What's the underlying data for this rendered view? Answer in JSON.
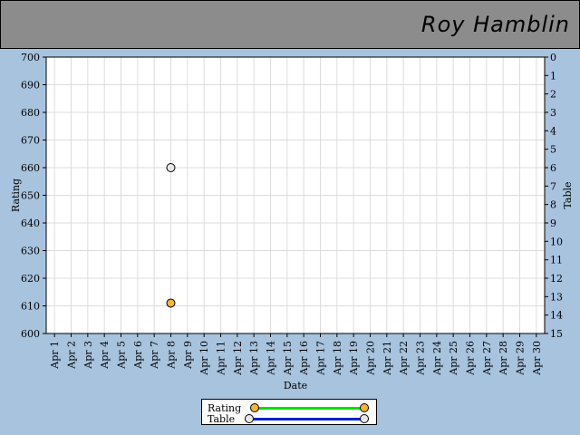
{
  "header": {
    "player_name": "Roy Hamblin"
  },
  "colors": {
    "rating_line": "#00e000",
    "rating_point": "#f5b72a",
    "table_line": "#0022cc",
    "table_point": "#e8e8e8",
    "background": "#a7c3de",
    "header_bg": "#8c8c8c"
  },
  "chart_data": {
    "type": "line",
    "xlabel": "Date",
    "ylabel_left": "Rating",
    "ylabel_right": "Table",
    "x_categories": [
      "Apr 1",
      "Apr 2",
      "Apr 3",
      "Apr 4",
      "Apr 5",
      "Apr 6",
      "Apr 7",
      "Apr 8",
      "Apr 9",
      "Apr 10",
      "Apr 11",
      "Apr 12",
      "Apr 13",
      "Apr 14",
      "Apr 15",
      "Apr 16",
      "Apr 17",
      "Apr 18",
      "Apr 19",
      "Apr 20",
      "Apr 21",
      "Apr 22",
      "Apr 23",
      "Apr 24",
      "Apr 25",
      "Apr 26",
      "Apr 27",
      "Apr 28",
      "Apr 29",
      "Apr 30"
    ],
    "y_left": {
      "min": 600,
      "max": 700,
      "ticks": [
        600,
        610,
        620,
        630,
        640,
        650,
        660,
        670,
        680,
        690,
        700
      ]
    },
    "y_right": {
      "min": 0,
      "max": 15,
      "inverted": true,
      "ticks": [
        0,
        1,
        2,
        3,
        4,
        5,
        6,
        7,
        8,
        9,
        10,
        11,
        12,
        13,
        14,
        15
      ]
    },
    "grid": true,
    "legend_position": "bottom-center",
    "series": [
      {
        "name": "Rating",
        "axis": "left",
        "points": [
          {
            "x": "Apr 8",
            "y": 611
          }
        ]
      },
      {
        "name": "Table",
        "axis": "right",
        "points": [
          {
            "x": "Apr 8",
            "y": 6
          }
        ]
      }
    ]
  }
}
